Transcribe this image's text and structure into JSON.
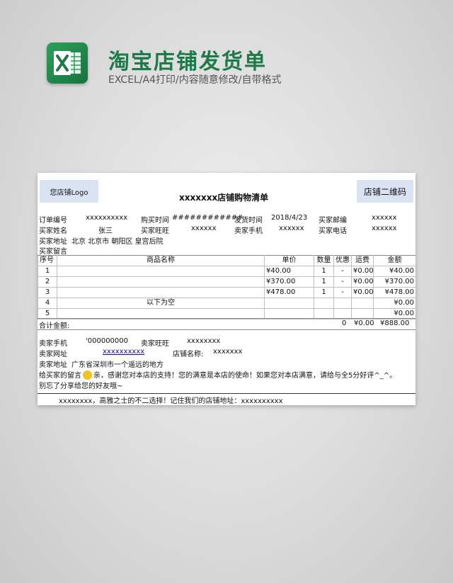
{
  "header": {
    "title": "淘宝店铺发货单",
    "subtitle": "EXCEL/A4打印/内容随意修改/自带格式",
    "app_icon": "excel-icon"
  },
  "sheet": {
    "logo_label": "您店铺Logo",
    "qr_label": "店铺二维码",
    "title": "xxxxxxx店铺购物清单",
    "info": {
      "order_no_label": "订单编号",
      "order_no": "xxxxxxxxxx",
      "buy_time_label": "购买时间",
      "buy_time": "############",
      "ship_time_label": "发货时间",
      "ship_time": "2018/4/23",
      "email_label": "买家邮编",
      "email": "xxxxxx",
      "name_label": "买家姓名",
      "name": "张三",
      "wangwang_label": "买家旺旺",
      "wangwang": "xxxxxx",
      "phone_label": "卖家手机",
      "phone": "xxxxxx",
      "tel_label": "买家电话",
      "tel": "xxxxxx",
      "addr_label": "买家地址",
      "addr": "北京 北京市 朝阳区 皇宫后院",
      "msg_label": "买家留言"
    },
    "table": {
      "headers": [
        "序号",
        "商品名称",
        "单价",
        "数量",
        "优惠",
        "运费",
        "金额"
      ],
      "rows": [
        [
          "1",
          "",
          "¥40.00",
          "1",
          "-",
          "¥0.00",
          "¥40.00"
        ],
        [
          "2",
          "",
          "¥370.00",
          "1",
          "-",
          "¥0.00",
          "¥370.00"
        ],
        [
          "3",
          "",
          "¥478.00",
          "1",
          "-",
          "¥0.00",
          "¥478.00"
        ],
        [
          "4",
          "以下为空",
          "",
          "",
          "",
          "",
          "¥0.00"
        ],
        [
          "5",
          "",
          "",
          "",
          "",
          "",
          "¥0.00"
        ]
      ],
      "total_label": "合计金额:",
      "total_qty": "0",
      "total_ship": "¥0.00",
      "total_amount": "¥888.00"
    },
    "seller": {
      "phone_label": "卖家手机",
      "phone": "'000000000",
      "wangwang_label": "卖家旺旺",
      "wangwang": "xxxxxxxx",
      "site_label": "卖家网址",
      "site": "xxxxxxxxxx",
      "shop_label": "店铺名称:",
      "shop": "xxxxxxx",
      "addr_label": "卖家地址",
      "addr": "广东省深圳市一个遥远的地方",
      "msg_label": "给买家的留言",
      "msg": "亲，感谢您对本店的支持！您的满意是本店的使命！如果您对本店满意，请给与全5分好评^_^。",
      "msg2": "别忘了分享给您的好友哦~",
      "footer": "xxxxxxxx，高雅之士的不二选择！记住我们的店铺地址：xxxxxxxxxx"
    }
  }
}
